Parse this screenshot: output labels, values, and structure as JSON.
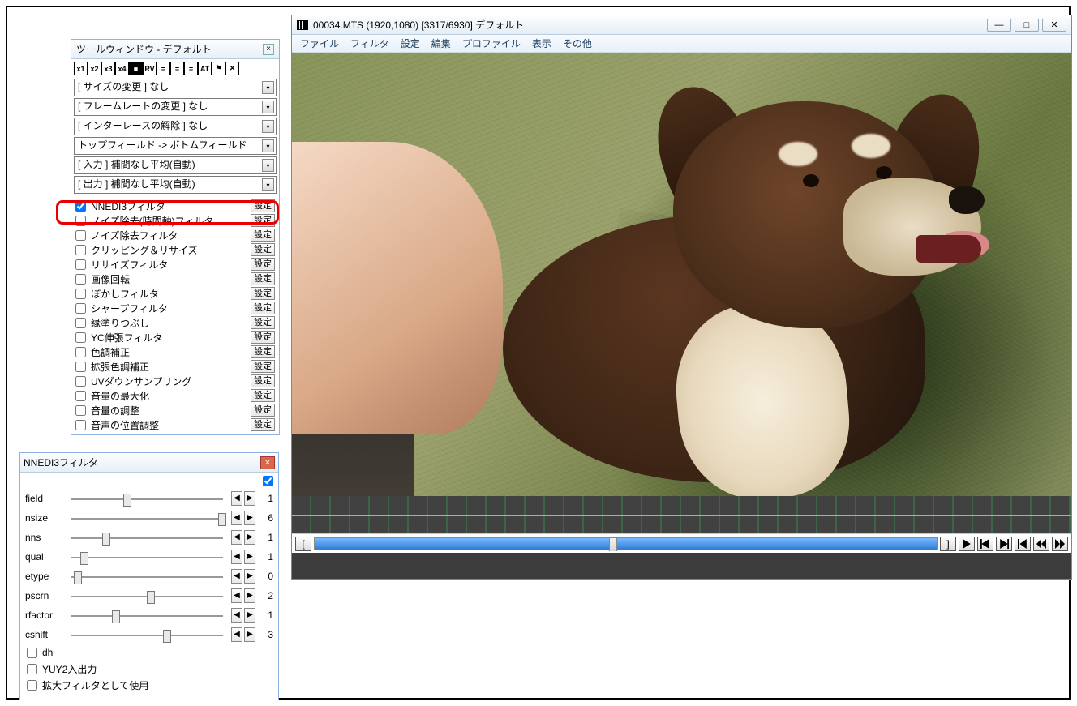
{
  "tool_window": {
    "title": "ツールウィンドウ - デフォルト",
    "icon_buttons": [
      "x1",
      "x2",
      "x3",
      "x4",
      "■",
      "RV",
      "=",
      "=",
      "=",
      "AT",
      "⚑",
      "✕"
    ],
    "dropdowns": [
      "[ サイズの変更 ] なし",
      "[ フレームレートの変更 ] なし",
      "[ インターレースの解除 ] なし",
      "トップフィールド -> ボトムフィールド",
      "[ 入力 ] 補間なし平均(自動)",
      "[ 出力 ] 補間なし平均(自動)"
    ],
    "settings_label": "設定",
    "filters": [
      {
        "label": "NNEDI3フィルタ",
        "checked": true
      },
      {
        "label": "ノイズ除去(時間軸)フィルタ",
        "checked": false
      },
      {
        "label": "ノイズ除去フィルタ",
        "checked": false
      },
      {
        "label": "クリッピング＆リサイズ",
        "checked": false
      },
      {
        "label": "リサイズフィルタ",
        "checked": false
      },
      {
        "label": "画像回転",
        "checked": false
      },
      {
        "label": "ぼかしフィルタ",
        "checked": false
      },
      {
        "label": "シャープフィルタ",
        "checked": false
      },
      {
        "label": "縁塗りつぶし",
        "checked": false
      },
      {
        "label": "YC伸張フィルタ",
        "checked": false
      },
      {
        "label": "色調補正",
        "checked": false
      },
      {
        "label": "拡張色調補正",
        "checked": false
      },
      {
        "label": "UVダウンサンプリング",
        "checked": false
      },
      {
        "label": "音量の最大化",
        "checked": false
      },
      {
        "label": "音量の調整",
        "checked": false
      },
      {
        "label": "音声の位置調整",
        "checked": false
      }
    ]
  },
  "nnedi3": {
    "title": "NNEDI3フィルタ",
    "enabled": true,
    "sliders": [
      {
        "name": "field",
        "value": 1,
        "pos": 35
      },
      {
        "name": "nsize",
        "value": 6,
        "pos": 95
      },
      {
        "name": "nns",
        "value": 1,
        "pos": 22
      },
      {
        "name": "qual",
        "value": 1,
        "pos": 8
      },
      {
        "name": "etype",
        "value": 0,
        "pos": 4
      },
      {
        "name": "pscrn",
        "value": 2,
        "pos": 50
      },
      {
        "name": "rfactor",
        "value": 1,
        "pos": 28
      },
      {
        "name": "cshift",
        "value": 3,
        "pos": 60
      }
    ],
    "checkboxes": [
      {
        "label": "dh",
        "checked": false
      },
      {
        "label": "YUY2入出力",
        "checked": false
      },
      {
        "label": "拡大フィルタとして使用",
        "checked": false
      }
    ]
  },
  "main": {
    "title": "00034.MTS (1920,1080) [3317/6930] デフォルト",
    "menus": [
      "ファイル",
      "フィルタ",
      "設定",
      "編集",
      "プロファイル",
      "表示",
      "その他"
    ],
    "window_controls": [
      "—",
      "□",
      "✕"
    ],
    "timeline": {
      "seg1_pct": 48,
      "seg2_pct": 52
    },
    "transport": [
      "play",
      "step-back",
      "step-fwd",
      "prev",
      "goto-start",
      "goto-end"
    ]
  }
}
